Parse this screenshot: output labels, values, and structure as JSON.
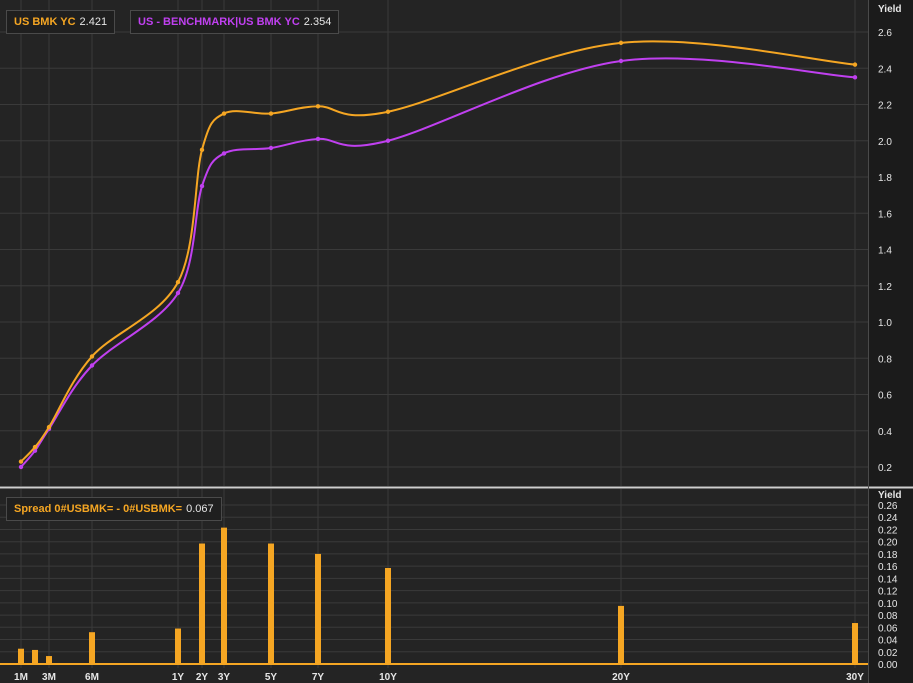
{
  "chart_data": [
    {
      "type": "line",
      "ylabel": "Yield",
      "ylim": [
        0.15,
        2.7
      ],
      "yticks": [
        0.2,
        0.4,
        0.6,
        0.8,
        1.0,
        1.2,
        1.4,
        1.6,
        1.8,
        2.0,
        2.2,
        2.4,
        2.6
      ],
      "grid": true,
      "series": [
        {
          "name": "US BMK YC",
          "last": "2.421",
          "color": "#f5a623",
          "points": [
            {
              "x": "1M",
              "y": 0.23
            },
            {
              "x": "2M",
              "y": 0.31
            },
            {
              "x": "3M",
              "y": 0.42
            },
            {
              "x": "6M",
              "y": 0.81
            },
            {
              "x": "1Y",
              "y": 1.22
            },
            {
              "x": "2Y",
              "y": 1.95
            },
            {
              "x": "3Y",
              "y": 2.15
            },
            {
              "x": "5Y",
              "y": 2.15
            },
            {
              "x": "7Y",
              "y": 2.19
            },
            {
              "x": "10Y",
              "y": 2.16
            },
            {
              "x": "20Y",
              "y": 2.54
            },
            {
              "x": "30Y",
              "y": 2.42
            }
          ]
        },
        {
          "name": "US - BENCHMARK|US BMK YC",
          "last": "2.354",
          "color": "#c040f0",
          "points": [
            {
              "x": "1M",
              "y": 0.2
            },
            {
              "x": "2M",
              "y": 0.29
            },
            {
              "x": "3M",
              "y": 0.41
            },
            {
              "x": "6M",
              "y": 0.76
            },
            {
              "x": "1Y",
              "y": 1.16
            },
            {
              "x": "2Y",
              "y": 1.75
            },
            {
              "x": "3Y",
              "y": 1.93
            },
            {
              "x": "5Y",
              "y": 1.96
            },
            {
              "x": "7Y",
              "y": 2.01
            },
            {
              "x": "10Y",
              "y": 2.0
            },
            {
              "x": "20Y",
              "y": 2.44
            },
            {
              "x": "30Y",
              "y": 2.35
            }
          ]
        }
      ]
    },
    {
      "type": "bar",
      "ylabel": "Yield",
      "ylim": [
        0,
        0.27
      ],
      "yticks": [
        0.0,
        0.02,
        0.04,
        0.06,
        0.08,
        0.1,
        0.12,
        0.14,
        0.16,
        0.18,
        0.2,
        0.22,
        0.24,
        0.26
      ],
      "series": [
        {
          "name": "Spread 0#USBMK= - 0#USBMK=",
          "last": "0.067",
          "color": "#f5a623",
          "points": [
            {
              "x": "1M",
              "y": 0.025
            },
            {
              "x": "2M",
              "y": 0.023
            },
            {
              "x": "3M",
              "y": 0.013
            },
            {
              "x": "6M",
              "y": 0.052
            },
            {
              "x": "1Y",
              "y": 0.058
            },
            {
              "x": "2Y",
              "y": 0.197
            },
            {
              "x": "3Y",
              "y": 0.223
            },
            {
              "x": "5Y",
              "y": 0.197
            },
            {
              "x": "7Y",
              "y": 0.18
            },
            {
              "x": "10Y",
              "y": 0.157
            },
            {
              "x": "20Y",
              "y": 0.095
            },
            {
              "x": "30Y",
              "y": 0.067
            }
          ]
        }
      ]
    }
  ],
  "x_tick_labels": [
    "1M",
    "3M",
    "6M",
    "1Y",
    "2Y",
    "3Y",
    "5Y",
    "7Y",
    "10Y",
    "20Y",
    "30Y"
  ],
  "tenor_years": {
    "1M": 0.0833,
    "2M": 0.1667,
    "3M": 0.25,
    "6M": 0.5,
    "1Y": 1,
    "2Y": 2,
    "3Y": 3,
    "5Y": 5,
    "7Y": 7,
    "10Y": 10,
    "20Y": 20,
    "30Y": 30
  },
  "legend": {
    "series1_name": "US BMK YC",
    "series1_value": "2.421",
    "series2_name": "US - BENCHMARK|US BMK YC",
    "series2_value": "2.354",
    "spread_name": "Spread 0#USBMK= - 0#USBMK=",
    "spread_value": "0.067"
  }
}
